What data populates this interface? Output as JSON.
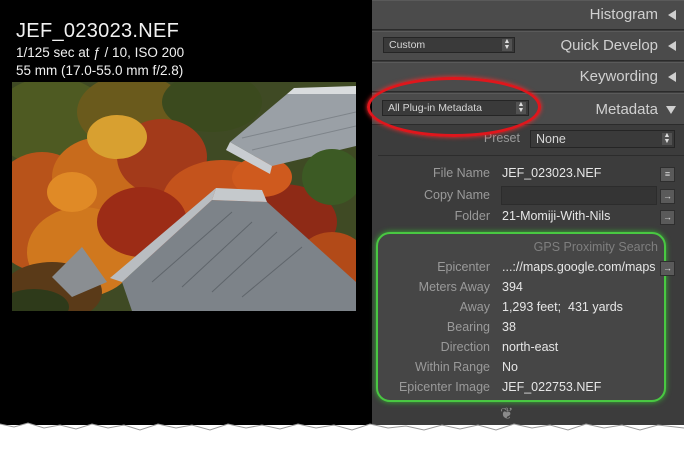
{
  "image_info": {
    "filename": "JEF_023023.NEF",
    "exposure": "1/125 sec at ƒ / 10, ISO 200",
    "lens": "55 mm (17.0-55.0 mm f/2.8)"
  },
  "panels": {
    "histogram": {
      "title": "Histogram"
    },
    "quick_develop": {
      "title": "Quick Develop",
      "preset": "Custom"
    },
    "keywording": {
      "title": "Keywording"
    },
    "metadata": {
      "title": "Metadata",
      "view_dropdown": "All Plug-in Metadata"
    }
  },
  "metadata": {
    "preset_label": "Preset",
    "preset_value": "None",
    "file_name_label": "File Name",
    "file_name_value": "JEF_023023.NEF",
    "copy_name_label": "Copy Name",
    "copy_name_value": "",
    "folder_label": "Folder",
    "folder_value": "21-Momiji-With-Nils"
  },
  "gps": {
    "title": "GPS Proximity Search",
    "rows": [
      {
        "label": "Epicenter",
        "value": "...://maps.google.com/maps"
      },
      {
        "label": "Meters Away",
        "value": "394"
      },
      {
        "label": "Away",
        "value": "1,293 feet;  431 yards"
      },
      {
        "label": "Bearing",
        "value": "38"
      },
      {
        "label": "Direction",
        "value": "north-east"
      },
      {
        "label": "Within Range",
        "value": "No"
      },
      {
        "label": "Epicenter Image",
        "value": "JEF_022753.NEF"
      }
    ]
  },
  "icons": {
    "arrow": "→",
    "list": "≡",
    "ornament": "❦"
  },
  "colors": {
    "panel_bg": "#3c3c3c",
    "header_bg": "#4b4b4b",
    "highlight_red": "#e0161c",
    "highlight_green": "#49c842"
  }
}
